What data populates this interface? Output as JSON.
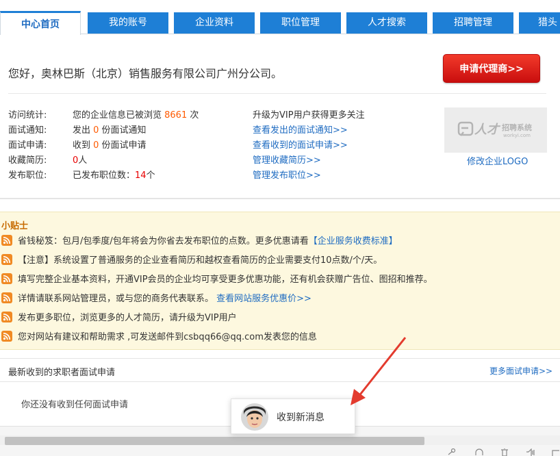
{
  "tabs": [
    {
      "label": "中心首页",
      "active": true
    },
    {
      "label": "我的账号",
      "active": false
    },
    {
      "label": "企业资料",
      "active": false
    },
    {
      "label": "职位管理",
      "active": false
    },
    {
      "label": "人才搜索",
      "active": false
    },
    {
      "label": "招聘管理",
      "active": false
    },
    {
      "label": "猎头",
      "active": false
    }
  ],
  "welcome": "您好，奥林巴斯（北京）销售服务有限公司广州分公司。",
  "agent_button": "申请代理商>>",
  "stats": {
    "visit": {
      "label": "访问统计:",
      "prefix": "您的企业信息已被浏览 ",
      "count": "8661",
      "suffix": " 次"
    },
    "interview_notice": {
      "label": "面试通知:",
      "prefix": "发出 ",
      "count": "0",
      "suffix": " 份面试通知"
    },
    "interview_apply": {
      "label": "面试申请:",
      "prefix": "收到 ",
      "count": "0",
      "suffix": " 份面试申请"
    },
    "favorites": {
      "label": "收藏简历:",
      "prefix": "",
      "count": "0",
      "suffix": "人"
    },
    "posted": {
      "label": "发布职位:",
      "prefix": "已发布职位数：",
      "count": "14",
      "suffix": "个"
    }
  },
  "links": {
    "vip_hint": "升级为VIP用户获得更多关注",
    "view_sent": "查看发出的面试通知>>",
    "view_received": "查看收到的面试申请>>",
    "manage_favorites": "管理收藏简历>>",
    "manage_posts": "管理发布职位>>"
  },
  "logo": {
    "text_main": "人才",
    "text_sub": "招聘系统",
    "domain": "workyi.com",
    "edit_label": "修改企业LOGO"
  },
  "tips": {
    "title": "小贴士",
    "items": [
      {
        "text": "省钱秘笈：包月/包季度/包年将会为你省去发布职位的点数。更多优惠请看",
        "link": "【企业服务收费标准】"
      },
      {
        "text": "【注意】系统设置了普通服务的企业查看简历和越权查看简历的企业需要支付10点数/个/天。",
        "link": ""
      },
      {
        "text": "填写完整企业基本资料，开通VIP会员的企业均可享受更多优惠功能，还有机会获赠广告位、图招和推荐。",
        "link": ""
      },
      {
        "text": "详情请联系网站管理员，或与您的商务代表联系。 ",
        "link": "查看网站服务优惠价>>"
      },
      {
        "text": "发布更多职位，浏览更多的人才简历，请升级为VIP用户",
        "link": ""
      },
      {
        "text": "您对网站有建议和帮助需求 ,可发送邮件到csbqq66@qq.com发表您的信息",
        "link": ""
      }
    ]
  },
  "applications": {
    "title": "最新收到的求职者面试申请",
    "more": "更多面试申请>>",
    "empty": "你还没有收到任何面试申请"
  },
  "notification": {
    "text": "收到新消息"
  },
  "colors": {
    "tab_blue": "#1e7fd6",
    "link_blue": "#1e6bc1",
    "agent_red": "#e01b14",
    "tips_bg": "#fdf8df",
    "tips_title": "#c76a00",
    "arrow": "#e33b2e"
  }
}
